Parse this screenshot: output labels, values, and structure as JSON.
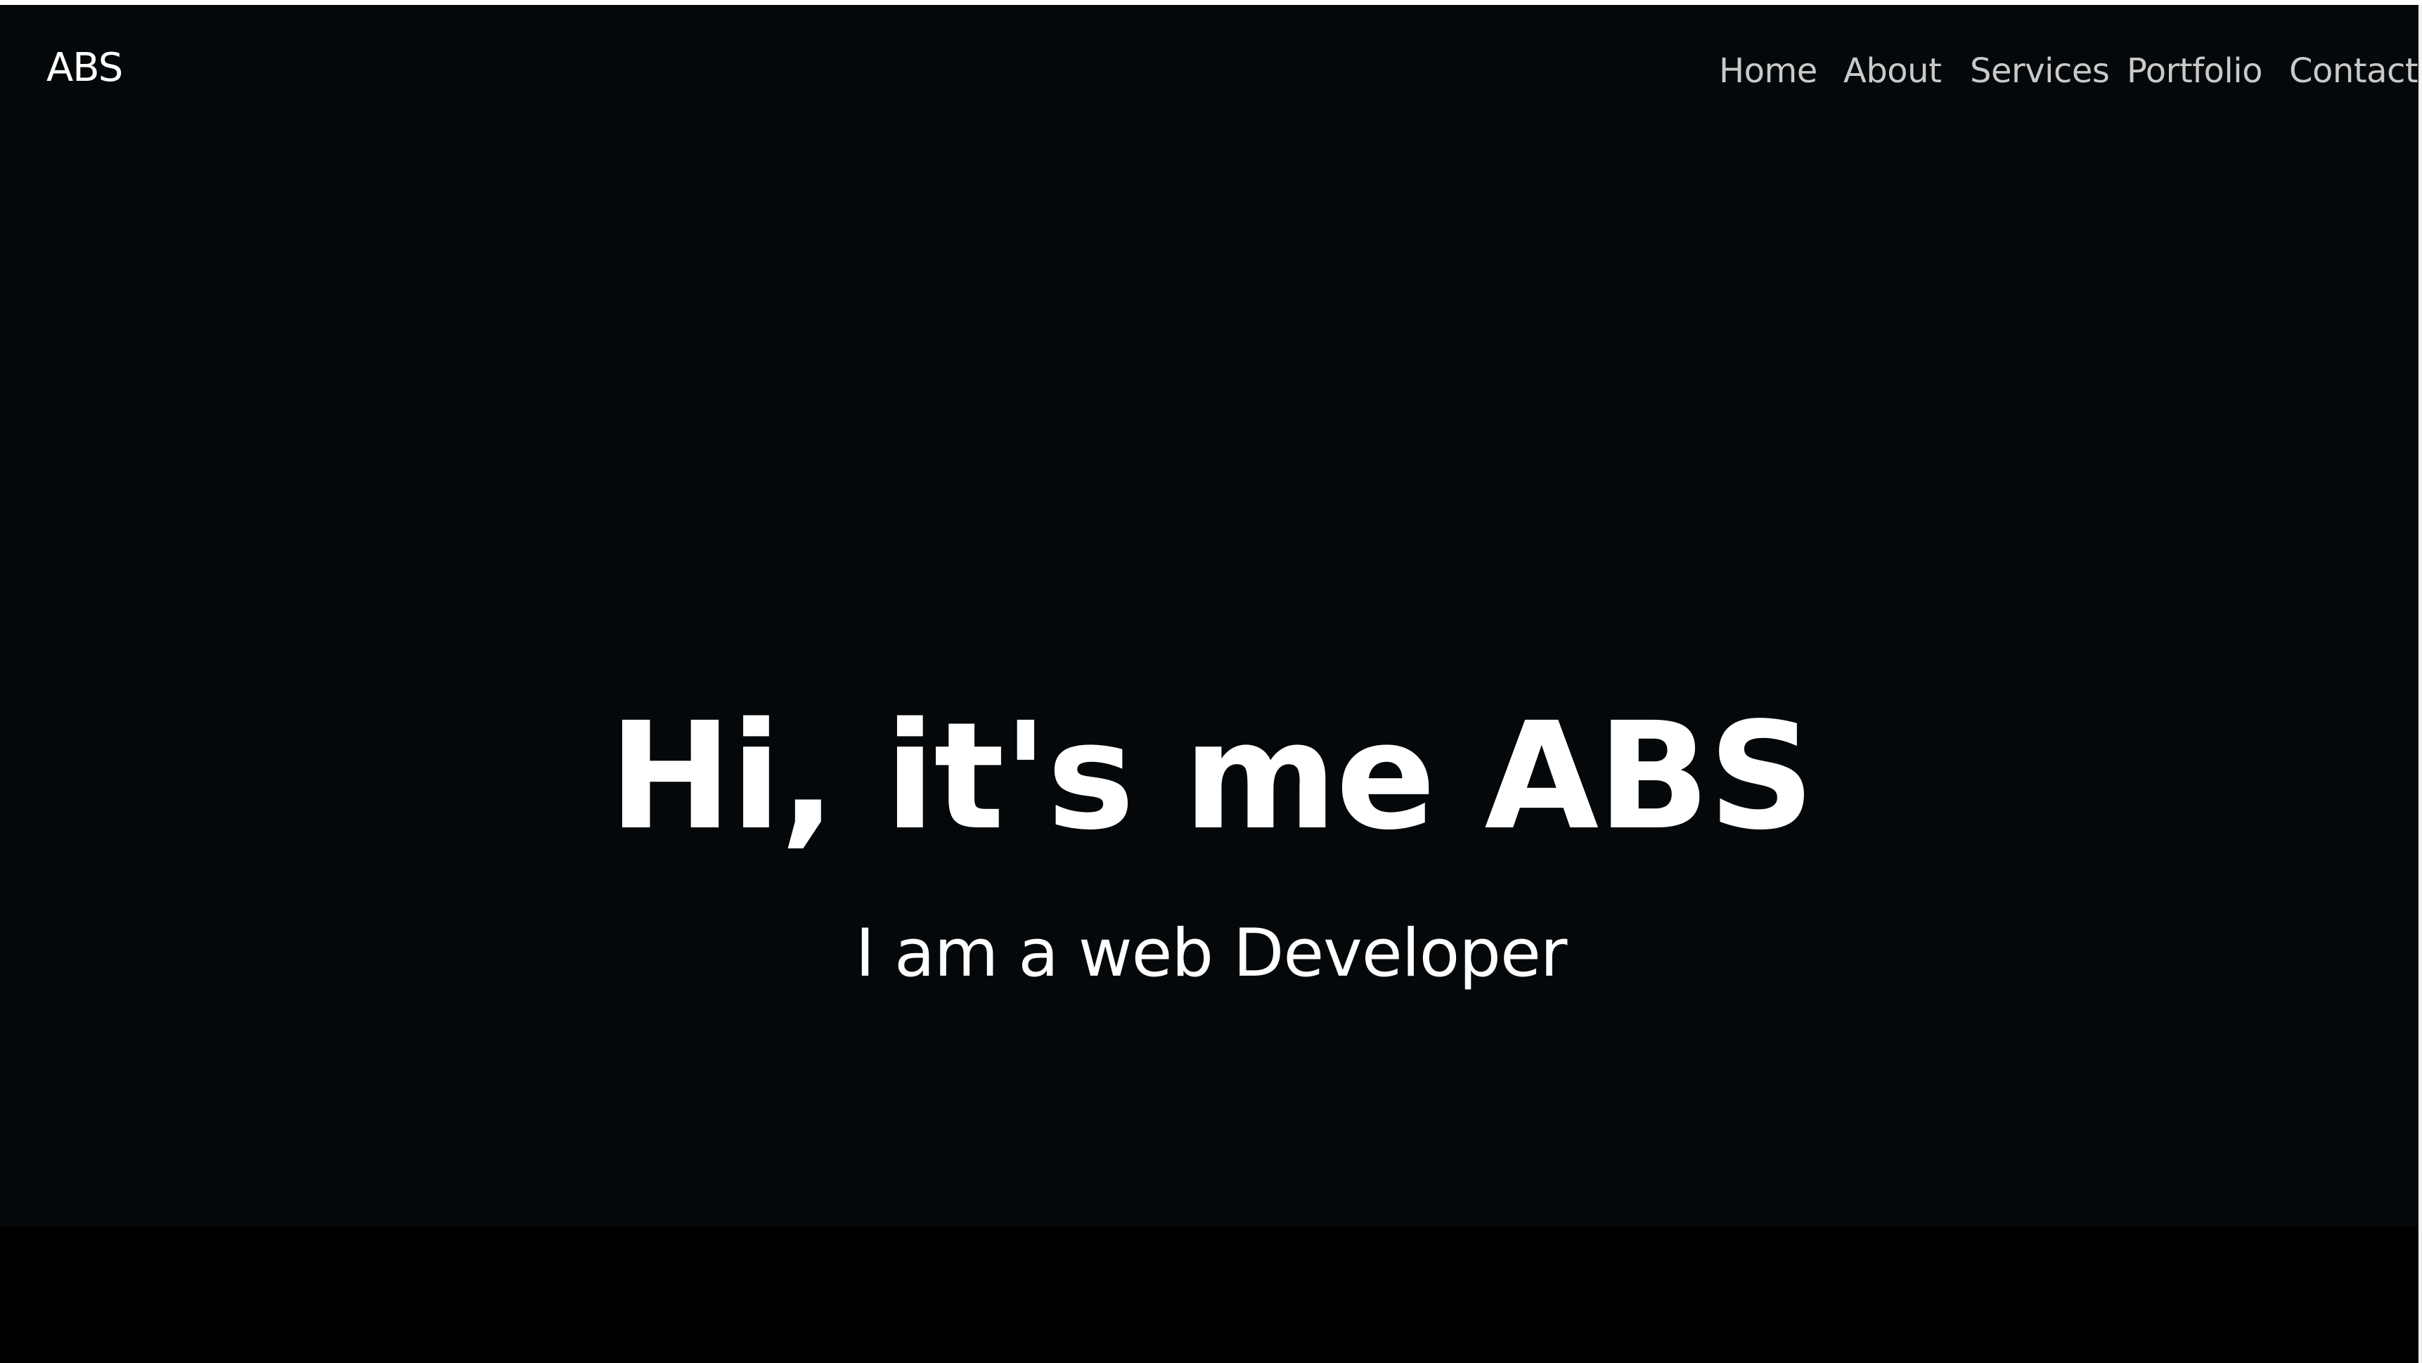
{
  "brand": {
    "logo_text": "ABS"
  },
  "nav": {
    "items": [
      {
        "label": "Home"
      },
      {
        "label": "About"
      },
      {
        "label": "Services"
      },
      {
        "label": "Portfolio"
      },
      {
        "label": "Contact"
      }
    ]
  },
  "hero": {
    "title": "Hi, it's me ABS",
    "subtitle": "I am a web Developer"
  },
  "colors": {
    "page_background": "#000000",
    "hero_background": "#05080a",
    "text_primary": "#ffffff",
    "nav_link": "#c9c9c9"
  }
}
